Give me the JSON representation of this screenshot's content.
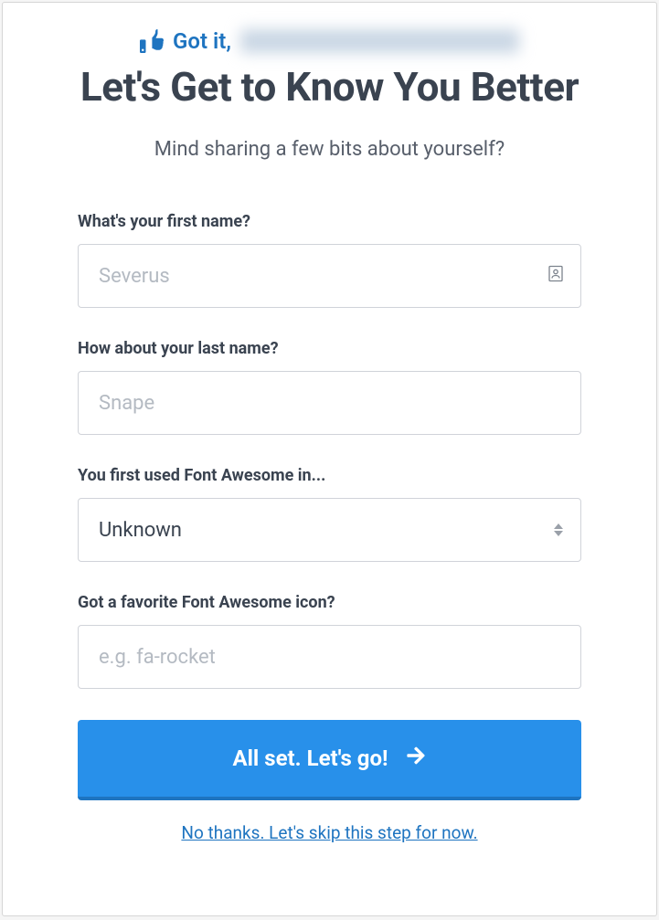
{
  "header": {
    "confirm_prefix": "Got it,",
    "title": "Let's Get to Know You Better",
    "subtitle": "Mind sharing a few bits about yourself?"
  },
  "form": {
    "first_name": {
      "label": "What's your first name?",
      "placeholder": "Severus",
      "value": ""
    },
    "last_name": {
      "label": "How about your last name?",
      "placeholder": "Snape",
      "value": ""
    },
    "first_used": {
      "label": "You first used Font Awesome in...",
      "selected": "Unknown"
    },
    "favorite_icon": {
      "label": "Got a favorite Font Awesome icon?",
      "placeholder": "e.g. fa-rocket",
      "value": ""
    },
    "submit_label": "All set. Let's go!",
    "skip_label": "No thanks. Let's skip this step for now."
  }
}
